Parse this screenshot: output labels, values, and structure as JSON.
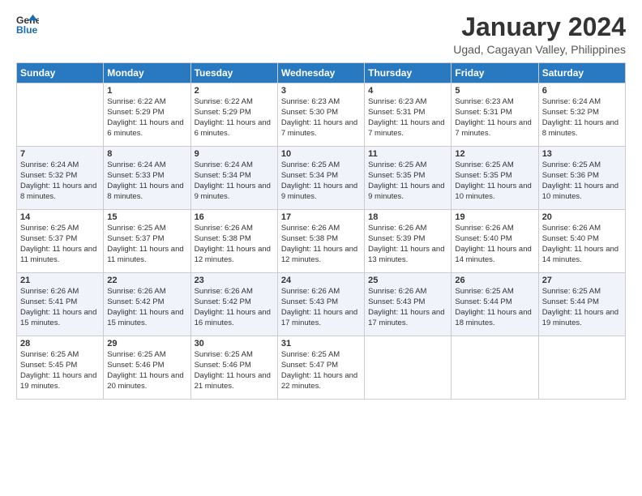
{
  "logo": {
    "line1": "General",
    "line2": "Blue"
  },
  "title": "January 2024",
  "subtitle": "Ugad, Cagayan Valley, Philippines",
  "weekdays": [
    "Sunday",
    "Monday",
    "Tuesday",
    "Wednesday",
    "Thursday",
    "Friday",
    "Saturday"
  ],
  "weeks": [
    [
      {
        "day": "",
        "sunrise": "",
        "sunset": "",
        "daylight": ""
      },
      {
        "day": "1",
        "sunrise": "Sunrise: 6:22 AM",
        "sunset": "Sunset: 5:29 PM",
        "daylight": "Daylight: 11 hours and 6 minutes."
      },
      {
        "day": "2",
        "sunrise": "Sunrise: 6:22 AM",
        "sunset": "Sunset: 5:29 PM",
        "daylight": "Daylight: 11 hours and 6 minutes."
      },
      {
        "day": "3",
        "sunrise": "Sunrise: 6:23 AM",
        "sunset": "Sunset: 5:30 PM",
        "daylight": "Daylight: 11 hours and 7 minutes."
      },
      {
        "day": "4",
        "sunrise": "Sunrise: 6:23 AM",
        "sunset": "Sunset: 5:31 PM",
        "daylight": "Daylight: 11 hours and 7 minutes."
      },
      {
        "day": "5",
        "sunrise": "Sunrise: 6:23 AM",
        "sunset": "Sunset: 5:31 PM",
        "daylight": "Daylight: 11 hours and 7 minutes."
      },
      {
        "day": "6",
        "sunrise": "Sunrise: 6:24 AM",
        "sunset": "Sunset: 5:32 PM",
        "daylight": "Daylight: 11 hours and 8 minutes."
      }
    ],
    [
      {
        "day": "7",
        "sunrise": "Sunrise: 6:24 AM",
        "sunset": "Sunset: 5:32 PM",
        "daylight": "Daylight: 11 hours and 8 minutes."
      },
      {
        "day": "8",
        "sunrise": "Sunrise: 6:24 AM",
        "sunset": "Sunset: 5:33 PM",
        "daylight": "Daylight: 11 hours and 8 minutes."
      },
      {
        "day": "9",
        "sunrise": "Sunrise: 6:24 AM",
        "sunset": "Sunset: 5:34 PM",
        "daylight": "Daylight: 11 hours and 9 minutes."
      },
      {
        "day": "10",
        "sunrise": "Sunrise: 6:25 AM",
        "sunset": "Sunset: 5:34 PM",
        "daylight": "Daylight: 11 hours and 9 minutes."
      },
      {
        "day": "11",
        "sunrise": "Sunrise: 6:25 AM",
        "sunset": "Sunset: 5:35 PM",
        "daylight": "Daylight: 11 hours and 9 minutes."
      },
      {
        "day": "12",
        "sunrise": "Sunrise: 6:25 AM",
        "sunset": "Sunset: 5:35 PM",
        "daylight": "Daylight: 11 hours and 10 minutes."
      },
      {
        "day": "13",
        "sunrise": "Sunrise: 6:25 AM",
        "sunset": "Sunset: 5:36 PM",
        "daylight": "Daylight: 11 hours and 10 minutes."
      }
    ],
    [
      {
        "day": "14",
        "sunrise": "Sunrise: 6:25 AM",
        "sunset": "Sunset: 5:37 PM",
        "daylight": "Daylight: 11 hours and 11 minutes."
      },
      {
        "day": "15",
        "sunrise": "Sunrise: 6:25 AM",
        "sunset": "Sunset: 5:37 PM",
        "daylight": "Daylight: 11 hours and 11 minutes."
      },
      {
        "day": "16",
        "sunrise": "Sunrise: 6:26 AM",
        "sunset": "Sunset: 5:38 PM",
        "daylight": "Daylight: 11 hours and 12 minutes."
      },
      {
        "day": "17",
        "sunrise": "Sunrise: 6:26 AM",
        "sunset": "Sunset: 5:38 PM",
        "daylight": "Daylight: 11 hours and 12 minutes."
      },
      {
        "day": "18",
        "sunrise": "Sunrise: 6:26 AM",
        "sunset": "Sunset: 5:39 PM",
        "daylight": "Daylight: 11 hours and 13 minutes."
      },
      {
        "day": "19",
        "sunrise": "Sunrise: 6:26 AM",
        "sunset": "Sunset: 5:40 PM",
        "daylight": "Daylight: 11 hours and 14 minutes."
      },
      {
        "day": "20",
        "sunrise": "Sunrise: 6:26 AM",
        "sunset": "Sunset: 5:40 PM",
        "daylight": "Daylight: 11 hours and 14 minutes."
      }
    ],
    [
      {
        "day": "21",
        "sunrise": "Sunrise: 6:26 AM",
        "sunset": "Sunset: 5:41 PM",
        "daylight": "Daylight: 11 hours and 15 minutes."
      },
      {
        "day": "22",
        "sunrise": "Sunrise: 6:26 AM",
        "sunset": "Sunset: 5:42 PM",
        "daylight": "Daylight: 11 hours and 15 minutes."
      },
      {
        "day": "23",
        "sunrise": "Sunrise: 6:26 AM",
        "sunset": "Sunset: 5:42 PM",
        "daylight": "Daylight: 11 hours and 16 minutes."
      },
      {
        "day": "24",
        "sunrise": "Sunrise: 6:26 AM",
        "sunset": "Sunset: 5:43 PM",
        "daylight": "Daylight: 11 hours and 17 minutes."
      },
      {
        "day": "25",
        "sunrise": "Sunrise: 6:26 AM",
        "sunset": "Sunset: 5:43 PM",
        "daylight": "Daylight: 11 hours and 17 minutes."
      },
      {
        "day": "26",
        "sunrise": "Sunrise: 6:25 AM",
        "sunset": "Sunset: 5:44 PM",
        "daylight": "Daylight: 11 hours and 18 minutes."
      },
      {
        "day": "27",
        "sunrise": "Sunrise: 6:25 AM",
        "sunset": "Sunset: 5:44 PM",
        "daylight": "Daylight: 11 hours and 19 minutes."
      }
    ],
    [
      {
        "day": "28",
        "sunrise": "Sunrise: 6:25 AM",
        "sunset": "Sunset: 5:45 PM",
        "daylight": "Daylight: 11 hours and 19 minutes."
      },
      {
        "day": "29",
        "sunrise": "Sunrise: 6:25 AM",
        "sunset": "Sunset: 5:46 PM",
        "daylight": "Daylight: 11 hours and 20 minutes."
      },
      {
        "day": "30",
        "sunrise": "Sunrise: 6:25 AM",
        "sunset": "Sunset: 5:46 PM",
        "daylight": "Daylight: 11 hours and 21 minutes."
      },
      {
        "day": "31",
        "sunrise": "Sunrise: 6:25 AM",
        "sunset": "Sunset: 5:47 PM",
        "daylight": "Daylight: 11 hours and 22 minutes."
      },
      {
        "day": "",
        "sunrise": "",
        "sunset": "",
        "daylight": ""
      },
      {
        "day": "",
        "sunrise": "",
        "sunset": "",
        "daylight": ""
      },
      {
        "day": "",
        "sunrise": "",
        "sunset": "",
        "daylight": ""
      }
    ]
  ]
}
